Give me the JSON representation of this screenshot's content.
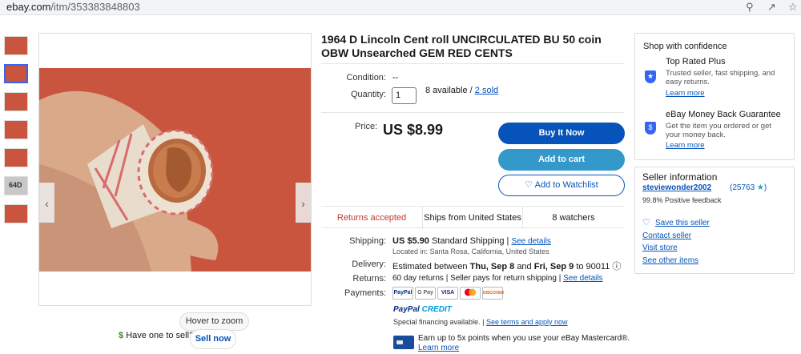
{
  "browser": {
    "url_host": "ebay.com",
    "url_path": "/itm/353383848803"
  },
  "thumbnails": [
    "thumb-1",
    "thumb-2",
    "thumb-3",
    "thumb-4",
    "thumb-5",
    "thumb-6",
    "thumb-7"
  ],
  "thumbnail_label": "64D",
  "gallery": {
    "zoom_hint": "Hover to zoom"
  },
  "sell": {
    "prompt": "Have one to sell?",
    "button": "Sell now"
  },
  "listing": {
    "title": "1964 D Lincoln Cent roll UNCIRCULATED BU 50 coin OBW Unsearched GEM RED CENTS",
    "condition_label": "Condition:",
    "condition_value": "--",
    "quantity_label": "Quantity:",
    "quantity_value": "1",
    "available": "8 available /",
    "sold": "2 sold",
    "price_label": "Price:",
    "price": "US $8.99"
  },
  "actions": {
    "buy_now": "Buy It Now",
    "add_to_cart": "Add to cart",
    "watchlist": "Add to Watchlist"
  },
  "stats": {
    "returns": "Returns accepted",
    "ships": "Ships from United States",
    "watchers": "8 watchers"
  },
  "shipping": {
    "label": "Shipping:",
    "cost": "US $5.90",
    "method": "Standard Shipping",
    "sep": "|",
    "details_link": "See details",
    "location": "Located in: Santa Rosa, California, United States"
  },
  "delivery": {
    "label": "Delivery:",
    "prefix": "Estimated between",
    "start": "Thu, Sep 8",
    "and": "and",
    "end": "Fri, Sep 9",
    "to": "to 90011"
  },
  "returns": {
    "label": "Returns:",
    "text": "60 day returns | Seller pays for return shipping |",
    "details_link": "See details"
  },
  "payments": {
    "label": "Payments:",
    "methods": [
      "PayPal",
      "G Pay",
      "VISA",
      "MC",
      "DISCOVER"
    ],
    "paypal_word": "PayPal",
    "credit_word": "CREDIT",
    "financing_text": "Special financing available. |",
    "financing_link": "See terms and apply now",
    "mastercard_text": "Earn up to 5x points when you use your eBay Mastercard®.",
    "mastercard_link": "Learn more"
  },
  "confidence": {
    "heading": "Shop with confidence",
    "items": [
      {
        "title": "Top Rated Plus",
        "desc": "Trusted seller, fast shipping, and easy returns.",
        "link": "Learn more"
      },
      {
        "title": "eBay Money Back Guarantee",
        "desc": "Get the item you ordered or get your money back.",
        "link": "Learn more"
      }
    ]
  },
  "seller": {
    "heading": "Seller information",
    "name": "steviewonder2002",
    "feedback": "(25763",
    "positive": "99.8% Positive feedback",
    "save": "Save this seller",
    "contact": "Contact seller",
    "store": "Visit store",
    "other": "See other items"
  },
  "colors": {
    "accent": "#0654ba",
    "cart": "#3498ca",
    "returns": "#c0392b",
    "photo_bg": "#c9553f"
  }
}
